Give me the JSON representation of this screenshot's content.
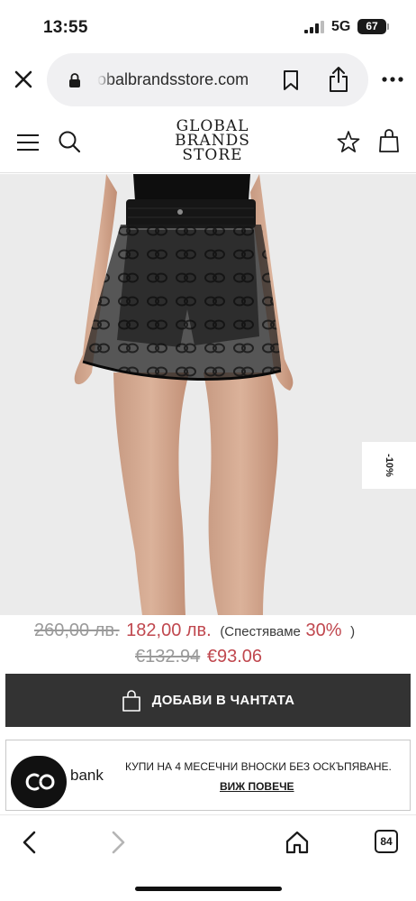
{
  "status_bar": {
    "time": "13:55",
    "network": "5G",
    "battery": "67"
  },
  "browser": {
    "url": "obalbrandsstore.com",
    "tabs_count": "84"
  },
  "site": {
    "logo_lines": [
      "GLOBAL",
      "BRANDS",
      "STORE"
    ]
  },
  "product": {
    "discount_badge": "-10%"
  },
  "prices": {
    "old_bgn": "260,00 лв.",
    "new_bgn": "182,00 лв.",
    "save_prefix": "(Спестяваме",
    "save_percent": "30%",
    "save_suffix": ")",
    "old_eur": "€132.94",
    "new_eur": "€93.06"
  },
  "cart": {
    "add_label": "ДОБАВИ В ЧАНТАТА"
  },
  "installments": {
    "title": "КУПИ НА 4 МЕСЕЧНИ ВНОСКИ БЕЗ ОСКЪПЯВАНЕ.",
    "link": "ВИЖ ПОВЕЧЕ",
    "bank_label": "bank"
  },
  "colors": {
    "sale_red": "#c0484f",
    "button_dark": "#333333",
    "image_bg": "#ebebeb"
  }
}
